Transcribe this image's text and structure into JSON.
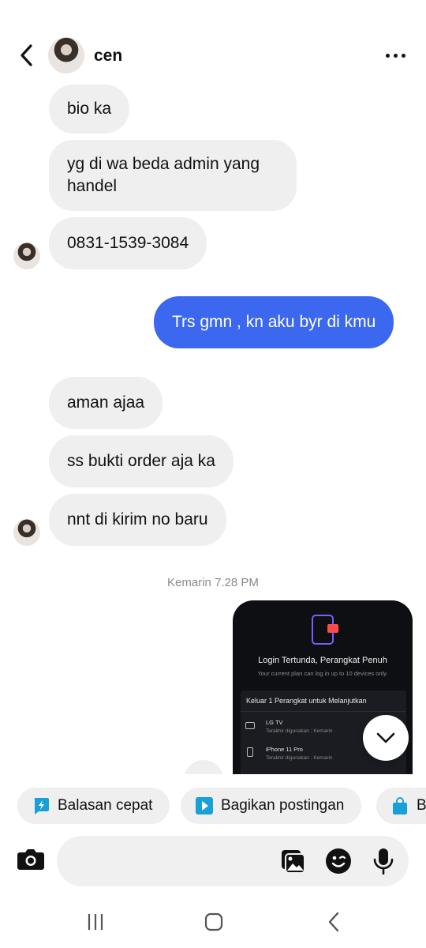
{
  "header": {
    "contact_name": "cen",
    "back_icon": "chevron-left-icon",
    "more_icon": "more-horizontal-icon"
  },
  "messages": [
    {
      "direction": "incoming",
      "text": "bio ka"
    },
    {
      "direction": "incoming",
      "text": "yg di wa beda admin yang handel"
    },
    {
      "direction": "incoming",
      "text": "0831-1539-3084"
    },
    {
      "direction": "outgoing",
      "text": "Trs gmn , kn aku byr di kmu"
    },
    {
      "direction": "incoming",
      "text": "aman ajaa"
    },
    {
      "direction": "incoming",
      "text": "ss bukti order aja ka"
    },
    {
      "direction": "incoming",
      "text": "nnt di kirim no baru"
    }
  ],
  "timestamp": "Kemarin 7.28 PM",
  "shared_image": {
    "title": "Login Tertunda, Perangkat Penuh",
    "subtitle": "Your current plan can log in up to 10 devices only.",
    "section_title": "Keluar 1 Perangkat untuk Melanjutkan",
    "devices": [
      {
        "name": "LG TV",
        "last_used": "Terakhir digunakan : Kemarin",
        "icon": "tv-icon"
      },
      {
        "name": "iPhone 11 Pro",
        "last_used": "Terakhir digunakan : Kemarin",
        "icon": "phone-icon"
      }
    ]
  },
  "quick_chips": [
    {
      "label": "Balasan cepat",
      "icon": "lightning-icon"
    },
    {
      "label": "Bagikan postingan",
      "icon": "play-icon"
    },
    {
      "label": "B",
      "icon": "shopping-bag-icon"
    }
  ],
  "composer": {
    "placeholder": "",
    "icons": [
      "camera-icon",
      "gallery-icon",
      "sticker-icon",
      "microphone-icon"
    ]
  },
  "colors": {
    "outgoing_bubble": "#3c68f0",
    "incoming_bubble": "#efefef",
    "chip_icon": "#1aa0d8"
  }
}
